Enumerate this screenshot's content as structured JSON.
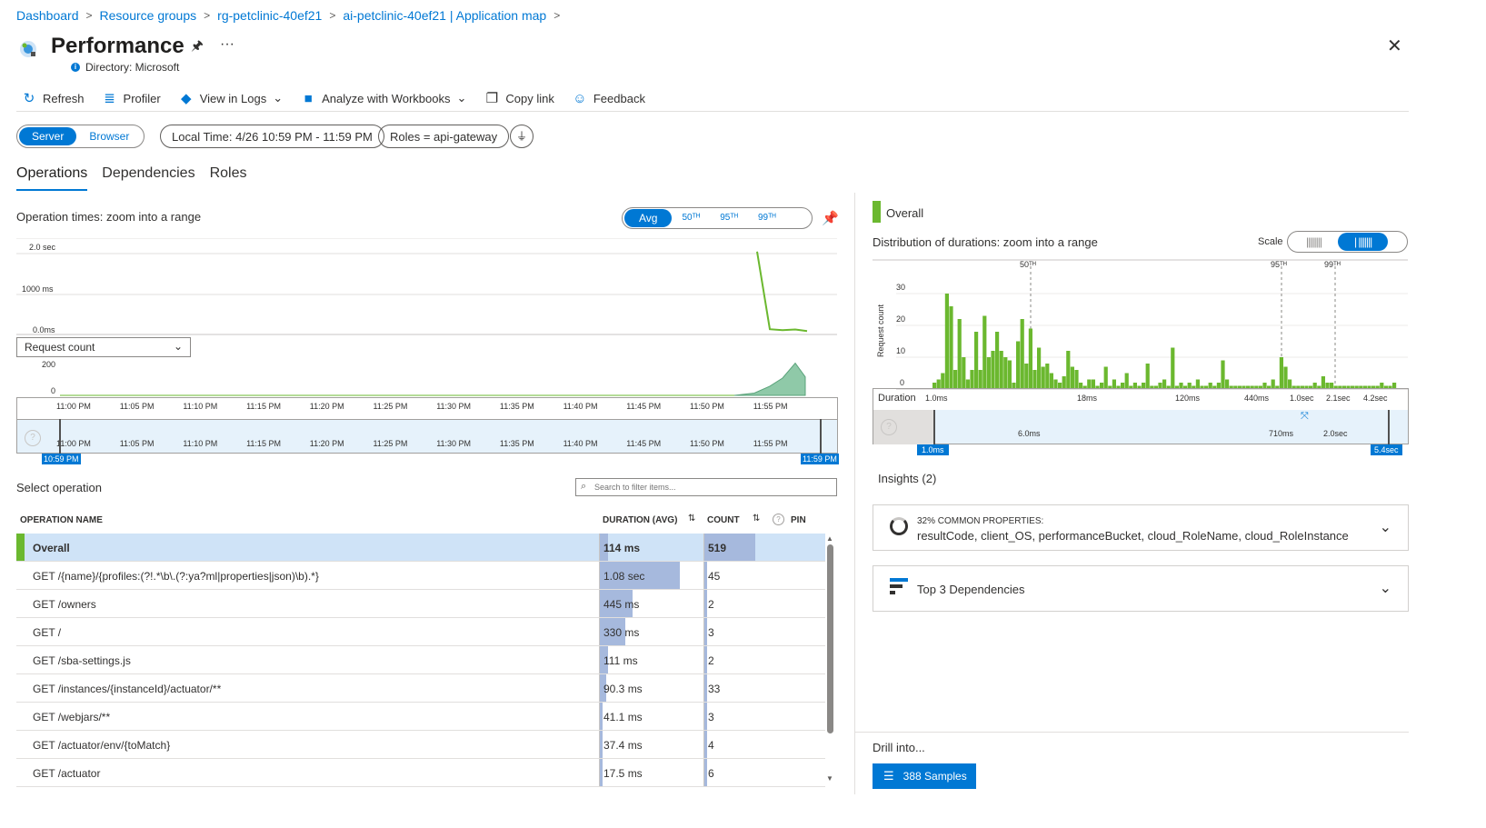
{
  "breadcrumb": [
    "Dashboard",
    "Resource groups",
    "rg-petclinic-40ef21",
    "ai-petclinic-40ef21 | Application map"
  ],
  "page": {
    "title": "Performance",
    "directory": "Directory: Microsoft"
  },
  "toolbar": {
    "refresh": "Refresh",
    "profiler": "Profiler",
    "view_in_logs": "View in Logs",
    "analyze": "Analyze with Workbooks",
    "copy_link": "Copy link",
    "feedback": "Feedback"
  },
  "filters": {
    "server": "Server",
    "browser": "Browser",
    "time": "Local Time: 4/26 10:59 PM - 11:59 PM",
    "roles": "Roles = api-gateway"
  },
  "tabs": [
    "Operations",
    "Dependencies",
    "Roles"
  ],
  "op_chart": {
    "title": "Operation times: zoom into a range",
    "toggle": [
      "Avg",
      "50ᵀᴴ",
      "95ᵀᴴ",
      "99ᵀᴴ"
    ],
    "y_labels": [
      "2.0 sec",
      "1000 ms",
      "0.0ms"
    ],
    "metric_select": "Request count",
    "count_labels": [
      "200",
      "0"
    ],
    "x_labels": [
      "11:00 PM",
      "11:05 PM",
      "11:10 PM",
      "11:15 PM",
      "11:20 PM",
      "11:25 PM",
      "11:30 PM",
      "11:35 PM",
      "11:40 PM",
      "11:45 PM",
      "11:50 PM",
      "11:55 PM"
    ],
    "range_start": "10:59 PM",
    "range_end": "11:59 PM"
  },
  "chart_data": [
    {
      "type": "line",
      "title": "Operation times: zoom into a range",
      "ylabel": "",
      "x": [
        "11:54 PM",
        "11:55 PM",
        "11:56 PM",
        "11:57 PM",
        "11:58 PM"
      ],
      "values": [
        1900,
        120,
        100,
        115,
        80
      ],
      "unit": "ms",
      "ylim": [
        0,
        2000
      ]
    },
    {
      "type": "area",
      "title": "Request count",
      "x": [
        "11:50 PM",
        "11:53 PM",
        "11:55 PM",
        "11:56 PM",
        "11:57 PM",
        "11:58 PM"
      ],
      "values": [
        0,
        20,
        80,
        150,
        280,
        160
      ],
      "ylim": [
        0,
        300
      ]
    },
    {
      "type": "bar",
      "title": "Distribution of durations: zoom into a range",
      "ylabel": "Request count",
      "xlabel": "Duration",
      "x_ticks": [
        "1.0ms",
        "18ms",
        "120ms",
        "440ms",
        "1.0sec",
        "2.1sec",
        "4.2sec"
      ],
      "ylim": [
        0,
        30
      ],
      "y_ticks": [
        0,
        10,
        20,
        30
      ],
      "values": [
        2,
        3,
        5,
        30,
        26,
        6,
        22,
        10,
        3,
        6,
        18,
        6,
        23,
        10,
        12,
        18,
        12,
        10,
        9,
        2,
        15,
        22,
        8,
        19,
        6,
        13,
        7,
        8,
        5,
        3,
        2,
        4,
        12,
        7,
        6,
        2,
        1,
        3,
        3,
        1,
        2,
        7,
        1,
        3,
        1,
        2,
        5,
        1,
        2,
        1,
        2,
        8,
        1,
        1,
        2,
        3,
        1,
        13,
        1,
        2,
        1,
        2,
        1,
        3,
        1,
        1,
        2,
        1,
        2,
        9,
        3,
        1,
        1,
        1,
        1,
        1,
        1,
        1,
        1,
        2,
        1,
        3,
        1,
        10,
        7,
        3,
        1,
        1,
        1,
        1,
        1,
        2,
        1,
        4,
        2,
        2,
        1,
        1,
        1,
        1,
        1,
        1,
        1,
        1,
        1,
        1,
        1,
        2,
        1,
        1,
        2
      ]
    }
  ],
  "operations": {
    "label": "Select operation",
    "search_placeholder": "Search to filter items...",
    "columns": {
      "name": "OPERATION NAME",
      "duration": "DURATION (AVG)",
      "count": "COUNT",
      "pin": "PIN"
    },
    "rows": [
      {
        "name": "Overall",
        "duration": "114 ms",
        "dur_frac": 0.085,
        "count": "519",
        "cnt_frac": 1.0
      },
      {
        "name": "GET /{name}/{profiles:(?!.*\\b\\.(?:ya?ml|properties|json)\\b).*}",
        "duration": "1.08 sec",
        "dur_frac": 0.8,
        "count": "45",
        "cnt_frac": 0.06
      },
      {
        "name": "GET /owners",
        "duration": "445 ms",
        "dur_frac": 0.33,
        "count": "2",
        "cnt_frac": 0.01
      },
      {
        "name": "GET /",
        "duration": "330 ms",
        "dur_frac": 0.25,
        "count": "3",
        "cnt_frac": 0.01
      },
      {
        "name": "GET /sba-settings.js",
        "duration": "111 ms",
        "dur_frac": 0.08,
        "count": "2",
        "cnt_frac": 0.01
      },
      {
        "name": "GET /instances/{instanceId}/actuator/**",
        "duration": "90.3 ms",
        "dur_frac": 0.06,
        "count": "33",
        "cnt_frac": 0.04
      },
      {
        "name": "GET /webjars/**",
        "duration": "41.1 ms",
        "dur_frac": 0.03,
        "count": "3",
        "cnt_frac": 0.01
      },
      {
        "name": "GET /actuator/env/{toMatch}",
        "duration": "37.4 ms",
        "dur_frac": 0.025,
        "count": "4",
        "cnt_frac": 0.01
      },
      {
        "name": "GET /actuator",
        "duration": "17.5 ms",
        "dur_frac": 0.015,
        "count": "6",
        "cnt_frac": 0.01
      }
    ]
  },
  "right": {
    "overall": "Overall",
    "dist_title": "Distribution of durations: zoom into a range",
    "scale_label": "Scale",
    "percentiles": [
      "50ᵀᴴ",
      "95ᵀᴴ",
      "99ᵀᴴ"
    ],
    "y_axis": "Request count",
    "y_ticks": [
      "30",
      "20",
      "10",
      "0"
    ],
    "duration_label": "Duration",
    "x_ticks": [
      "1.0ms",
      "18ms",
      "120ms",
      "440ms",
      "1.0sec",
      "2.1sec",
      "4.2sec"
    ],
    "brush_ticks": [
      "6.0ms",
      "710ms",
      "2.0sec"
    ],
    "range_start": "1.0ms",
    "range_end": "5.4sec",
    "insights_title": "Insights (2)",
    "insight1_label": "32% COMMON PROPERTIES:",
    "insight1_value": "resultCode, client_OS, performanceBucket, cloud_RoleName, cloud_RoleInstance",
    "insight2_label": "Top 3 Dependencies",
    "drill_label": "Drill into...",
    "samples_button": "388 Samples"
  },
  "colors": {
    "accent": "#0078d4",
    "green": "#6bb82f",
    "bar": "#a6b9dd"
  }
}
